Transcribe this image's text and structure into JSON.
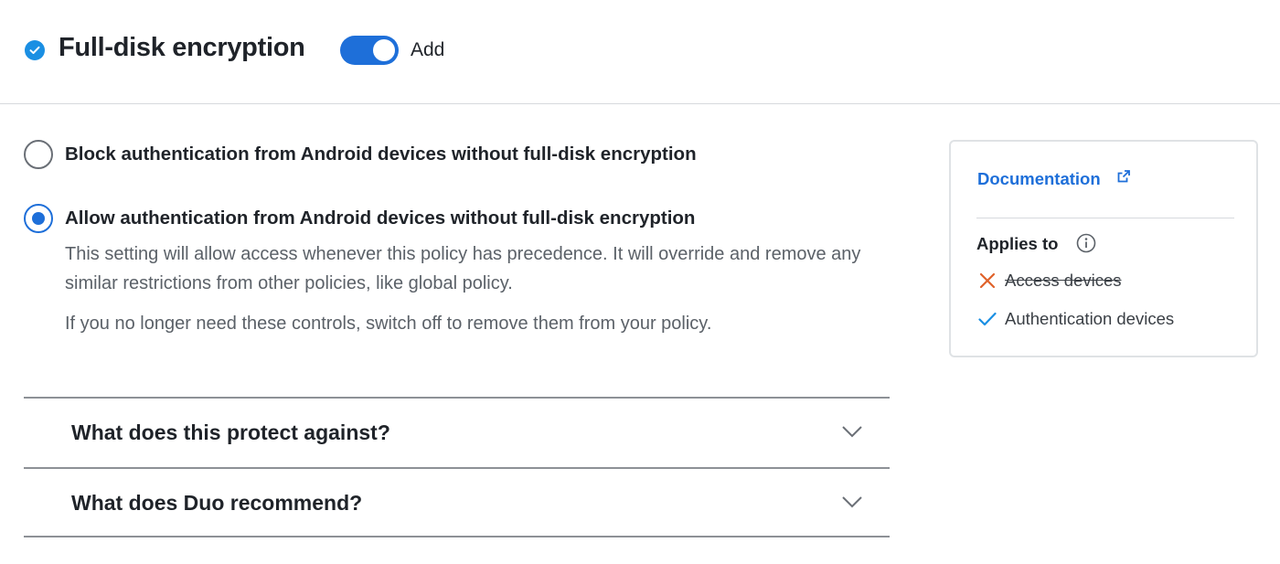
{
  "header": {
    "title": "Full-disk encryption",
    "toggle_label": "Add",
    "toggle_on": true
  },
  "options": [
    {
      "label": "Block authentication from Android devices without full-disk encryption",
      "selected": false
    },
    {
      "label": "Allow authentication from Android devices without full-disk encryption",
      "selected": true,
      "description": "This setting will allow access whenever this policy has precedence. It will override and remove any similar restrictions from other policies, like global policy.",
      "note": "If you no longer need these controls, switch off to remove them from your policy."
    }
  ],
  "accordion": [
    {
      "label": "What does this protect against?"
    },
    {
      "label": "What does Duo recommend?"
    }
  ],
  "side_card": {
    "documentation_label": "Documentation",
    "applies_to_title": "Applies to",
    "items": [
      {
        "label": "Access devices",
        "applies": false
      },
      {
        "label": "Authentication devices",
        "applies": true
      }
    ]
  },
  "colors": {
    "accent": "#1e6fd9",
    "status": "#1a8fe3",
    "cross": "#e0622a",
    "check": "#1a8fe3"
  },
  "icons": {
    "status": "check-circle-icon",
    "external_link": "external-link-icon",
    "info": "info-icon",
    "not_applies": "x-icon",
    "applies": "check-icon",
    "accordion": "chevron-down-icon"
  }
}
